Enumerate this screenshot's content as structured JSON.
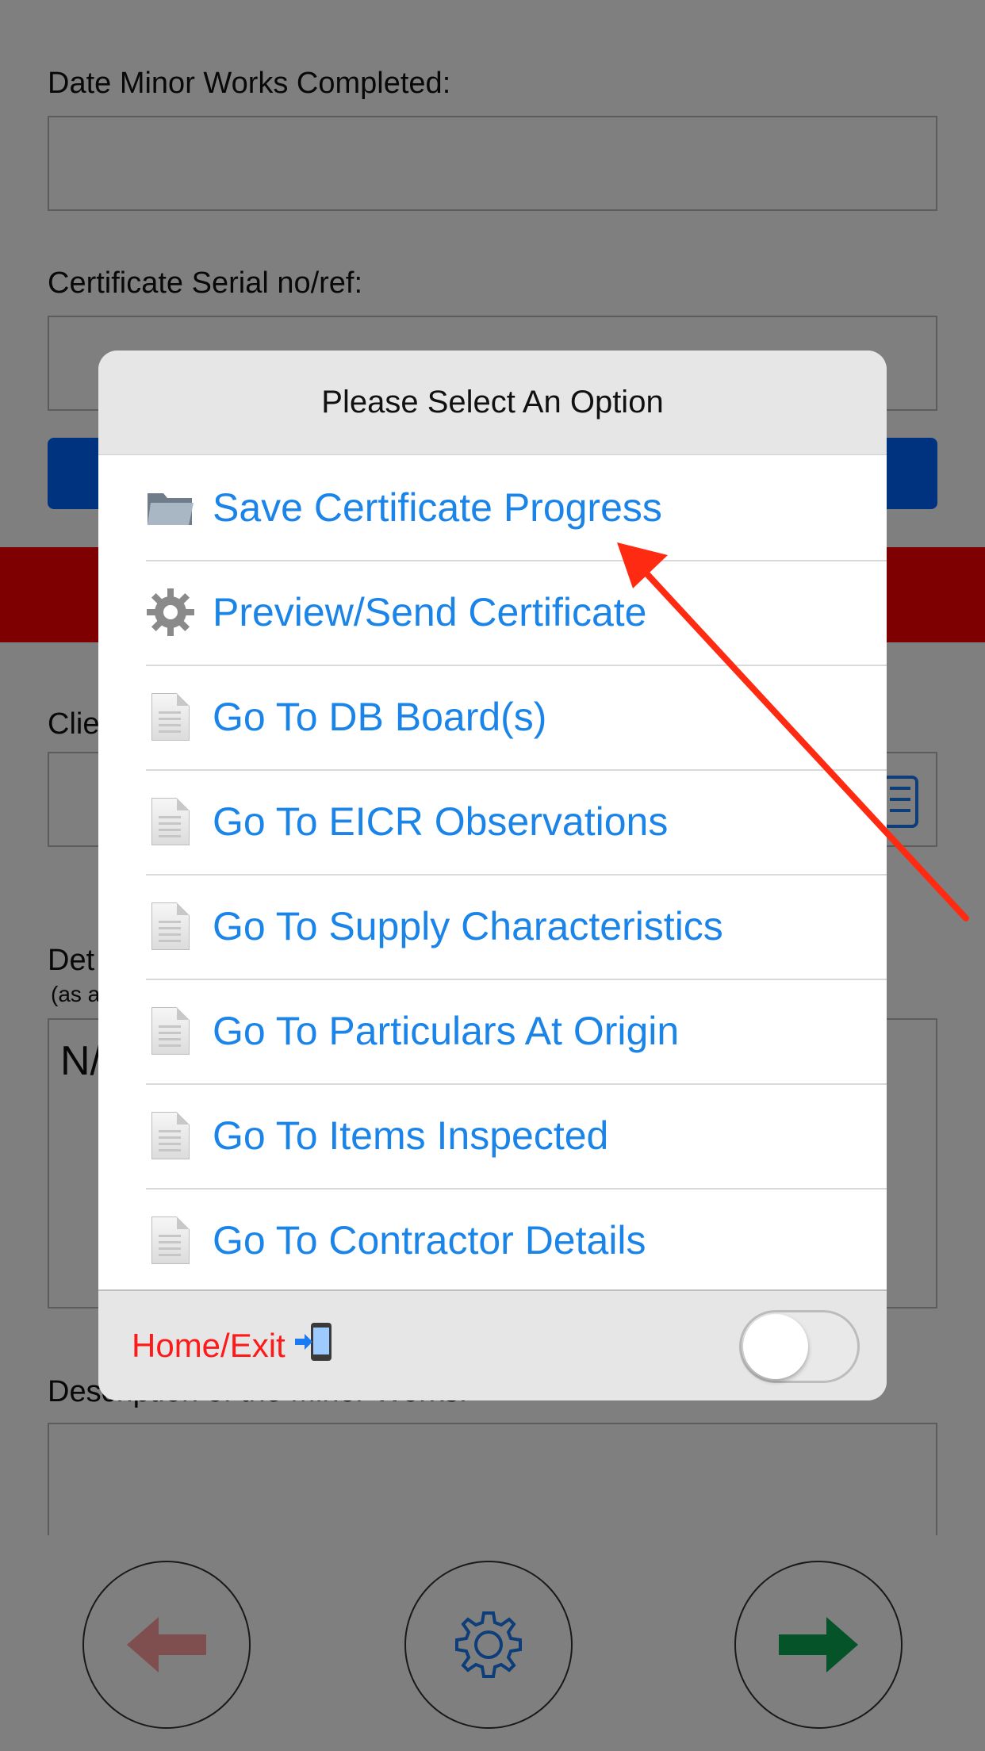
{
  "form": {
    "date_label": "Date Minor Works Completed:",
    "serial_label": "Certificate Serial no/ref:",
    "client_label_partial": "Clie",
    "details_label_partial": "Det",
    "details_sub_partial": "(as a",
    "details_value_partial": "N/",
    "description_label": "Description of the Minor Works:"
  },
  "bottom_bar": {
    "back_icon": "left-arrow-icon",
    "settings_icon": "gear-icon",
    "next_icon": "right-arrow-icon"
  },
  "dialog": {
    "title": "Please Select An Option",
    "items": [
      {
        "label": "Save Certificate Progress",
        "icon": "folder-icon"
      },
      {
        "label": "Preview/Send Certificate",
        "icon": "gear-icon"
      },
      {
        "label": "Go To DB Board(s)",
        "icon": "document-icon"
      },
      {
        "label": "Go To EICR Observations",
        "icon": "document-icon"
      },
      {
        "label": "Go To Supply Characteristics",
        "icon": "document-icon"
      },
      {
        "label": "Go To Particulars At Origin",
        "icon": "document-icon"
      },
      {
        "label": "Go To Items Inspected",
        "icon": "document-icon"
      },
      {
        "label": "Go To Contractor Details",
        "icon": "document-icon"
      }
    ],
    "footer": {
      "label": "Home/Exit",
      "icon": "phone-arrow-icon",
      "toggle_on": false
    }
  },
  "colors": {
    "accent_blue": "#1a84e8",
    "exit_red": "#ff1a1a",
    "annotation_red": "#ff2a12",
    "header_bg": "#e6e6e6"
  }
}
